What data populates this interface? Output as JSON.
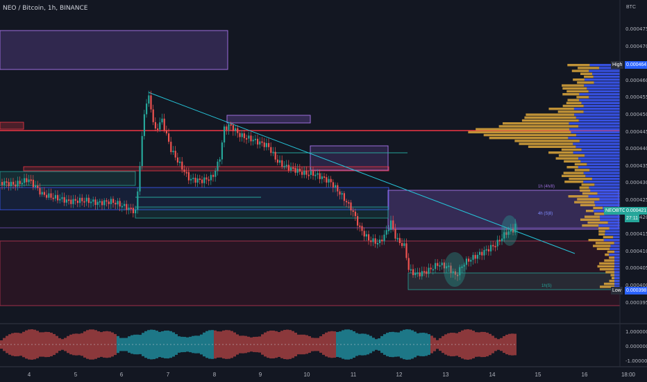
{
  "header": {
    "symbol_title": "NEO / Bitcoin, 1h, BINANCE",
    "axis_unit": "BTC"
  },
  "price_axis": {
    "ticks": [
      "0.000475",
      "0.000470",
      "0.000465",
      "0.000460",
      "0.000455",
      "0.000450",
      "0.000445",
      "0.000440",
      "0.000435",
      "0.000430",
      "0.000425",
      "0.000420",
      "0.000415",
      "0.000410",
      "0.000405",
      "0.000400",
      "0.000395"
    ]
  },
  "price_tags": {
    "high_label": "High",
    "high_value": "0.000464",
    "last_symbol": "NEOBTC",
    "last_value": "0.000421",
    "countdown": "27:11",
    "low_label": "Low",
    "low_value": "0.000398"
  },
  "zone_labels": {
    "upper": "1h (4h/8)",
    "mid": "4h (S|8)",
    "lower": "1h(S)"
  },
  "oscillator_axis": {
    "ticks": [
      "1.000000",
      "0.000000",
      "-1.000000"
    ]
  },
  "time_axis": {
    "labels": [
      "4",
      "5",
      "6",
      "7",
      "8",
      "9",
      "10",
      "11",
      "12",
      "13",
      "14",
      "15",
      "16",
      "18:00"
    ]
  },
  "colors": {
    "background": "#131722",
    "up": "#26a69a",
    "down": "#ef5350",
    "red_line": "#f23645",
    "orange_vol": "#d4a03a",
    "blue_vol": "#3d5afe",
    "cyan_line": "#26c6da",
    "purple_zone": "#7e57c2"
  }
}
